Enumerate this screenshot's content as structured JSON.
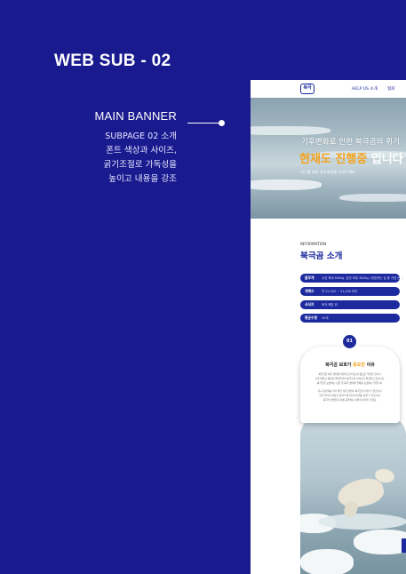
{
  "slide": {
    "title": "WEB SUB - 02",
    "section_label": "MAIN BANNER",
    "description": [
      "SUBPAGE 02 소개",
      "폰트 색상과 사이즈,",
      "굵기조절로 가독성을",
      "높이고 내용을 강조"
    ]
  },
  "mockup": {
    "header": {
      "logo": "북극",
      "nav": [
        "HELP US 소개",
        "협회"
      ]
    },
    "hero": {
      "line1": "기후변화로 인한 북극곰의 위기",
      "line2_highlight": "현재도 진행중",
      "line2_rest": "입니다",
      "sub": "지구를 위한 작은실천을 도와주세요"
    },
    "info": {
      "eyebrow": "INFORMATION",
      "title": "북극곰 소개",
      "rows": [
        {
          "label": "몸무게",
          "value": "수컷 최대 800kg, 암컷 최대 300kg / 현존하는 곰 중 가장 큰 곰"
        },
        {
          "label": "개체수",
          "value": "약 22,000 ~ 31,000 마리"
        },
        {
          "label": "서식지",
          "value": "북극 해빙 위"
        },
        {
          "label": "평균수명",
          "value": "25세"
        }
      ]
    },
    "card": {
      "badge": "01",
      "title_before": "북극곰 보호가 ",
      "title_highlight": "중요한",
      "title_after": " 이유",
      "paragraphs": [
        "북극곰은 북극 생태계 최상위 포식자로서 중요한 역할을 합니다.",
        "기후 변화로 해빙이 줄어들면서 북극곰의 서식지가 위협받고 있습니다.",
        "북극곰을 보호하는 것은 곧 북극 생태계 전체를 보호하는 일입니다.",
        "지구 온난화를 막기 위한 작은 실천이 북극곰을 지킬 수 있습니다.",
        "지금 우리의 관심과 참여가 북극곰의 미래를 바꿀 수 있습니다.",
        "북극의 생명들과 함께 공존하는 내일을 만들어 주세요."
      ]
    }
  },
  "colors": {
    "background": "#1a1a8f",
    "accent": "#1c2a9e",
    "highlight": "#f6a21b"
  }
}
